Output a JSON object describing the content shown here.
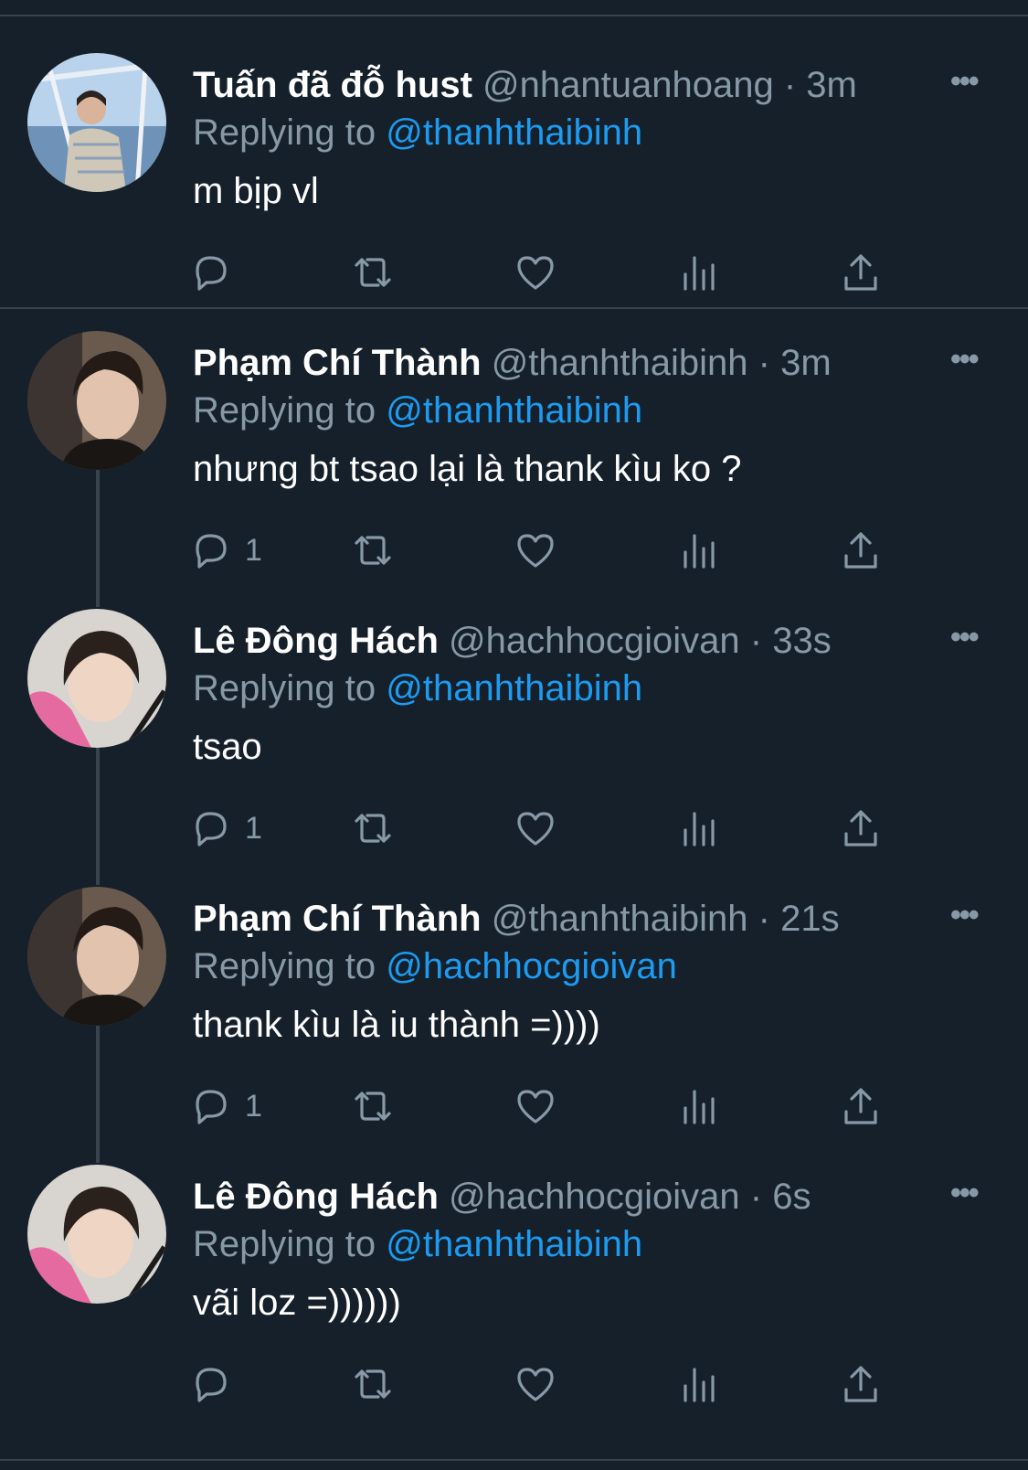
{
  "theme": {
    "background": "#15202b",
    "divider": "#38444d",
    "muted": "#8899a6",
    "link": "#1d9bf0"
  },
  "tweets": [
    {
      "name": "Tuấn đã đỗ hust",
      "handle": "@nhantuanhoang",
      "dot": "·",
      "time": "3m",
      "replying_prefix": "Replying to",
      "replying_to": "@thanhthaibinh",
      "text": "m bịp vl",
      "reply_count": "",
      "avatar": "boat-photo"
    },
    {
      "name": "Phạm Chí Thành",
      "handle": "@thanhthaibinh",
      "dot": "·",
      "time": "3m",
      "replying_prefix": "Replying to",
      "replying_to": "@thanhthaibinh",
      "text": "nhưng bt tsao lại là thank kìu ko ?",
      "reply_count": "1",
      "avatar": "dark-hair-portrait"
    },
    {
      "name": "Lê Đông Hách",
      "handle": "@hachhocgioivan",
      "dot": "·",
      "time": "33s",
      "replying_prefix": "Replying to",
      "replying_to": "@thanhthaibinh",
      "text": "tsao",
      "reply_count": "1",
      "avatar": "pink-hoodie-portrait"
    },
    {
      "name": "Phạm Chí Thành",
      "handle": "@thanhthaibinh",
      "dot": "·",
      "time": "21s",
      "replying_prefix": "Replying to",
      "replying_to": "@hachhocgioivan",
      "text": "thank kìu là iu thành =))))",
      "reply_count": "1",
      "avatar": "dark-hair-portrait"
    },
    {
      "name": "Lê Đông Hách",
      "handle": "@hachhocgioivan",
      "dot": "·",
      "time": "6s",
      "replying_prefix": "Replying to",
      "replying_to": "@thanhthaibinh",
      "text": "vãi loz =))))))",
      "reply_count": "",
      "avatar": "pink-hoodie-portrait"
    }
  ],
  "more_label": "•••",
  "icons": [
    "reply-icon",
    "retweet-icon",
    "like-icon",
    "analytics-icon",
    "share-icon"
  ]
}
